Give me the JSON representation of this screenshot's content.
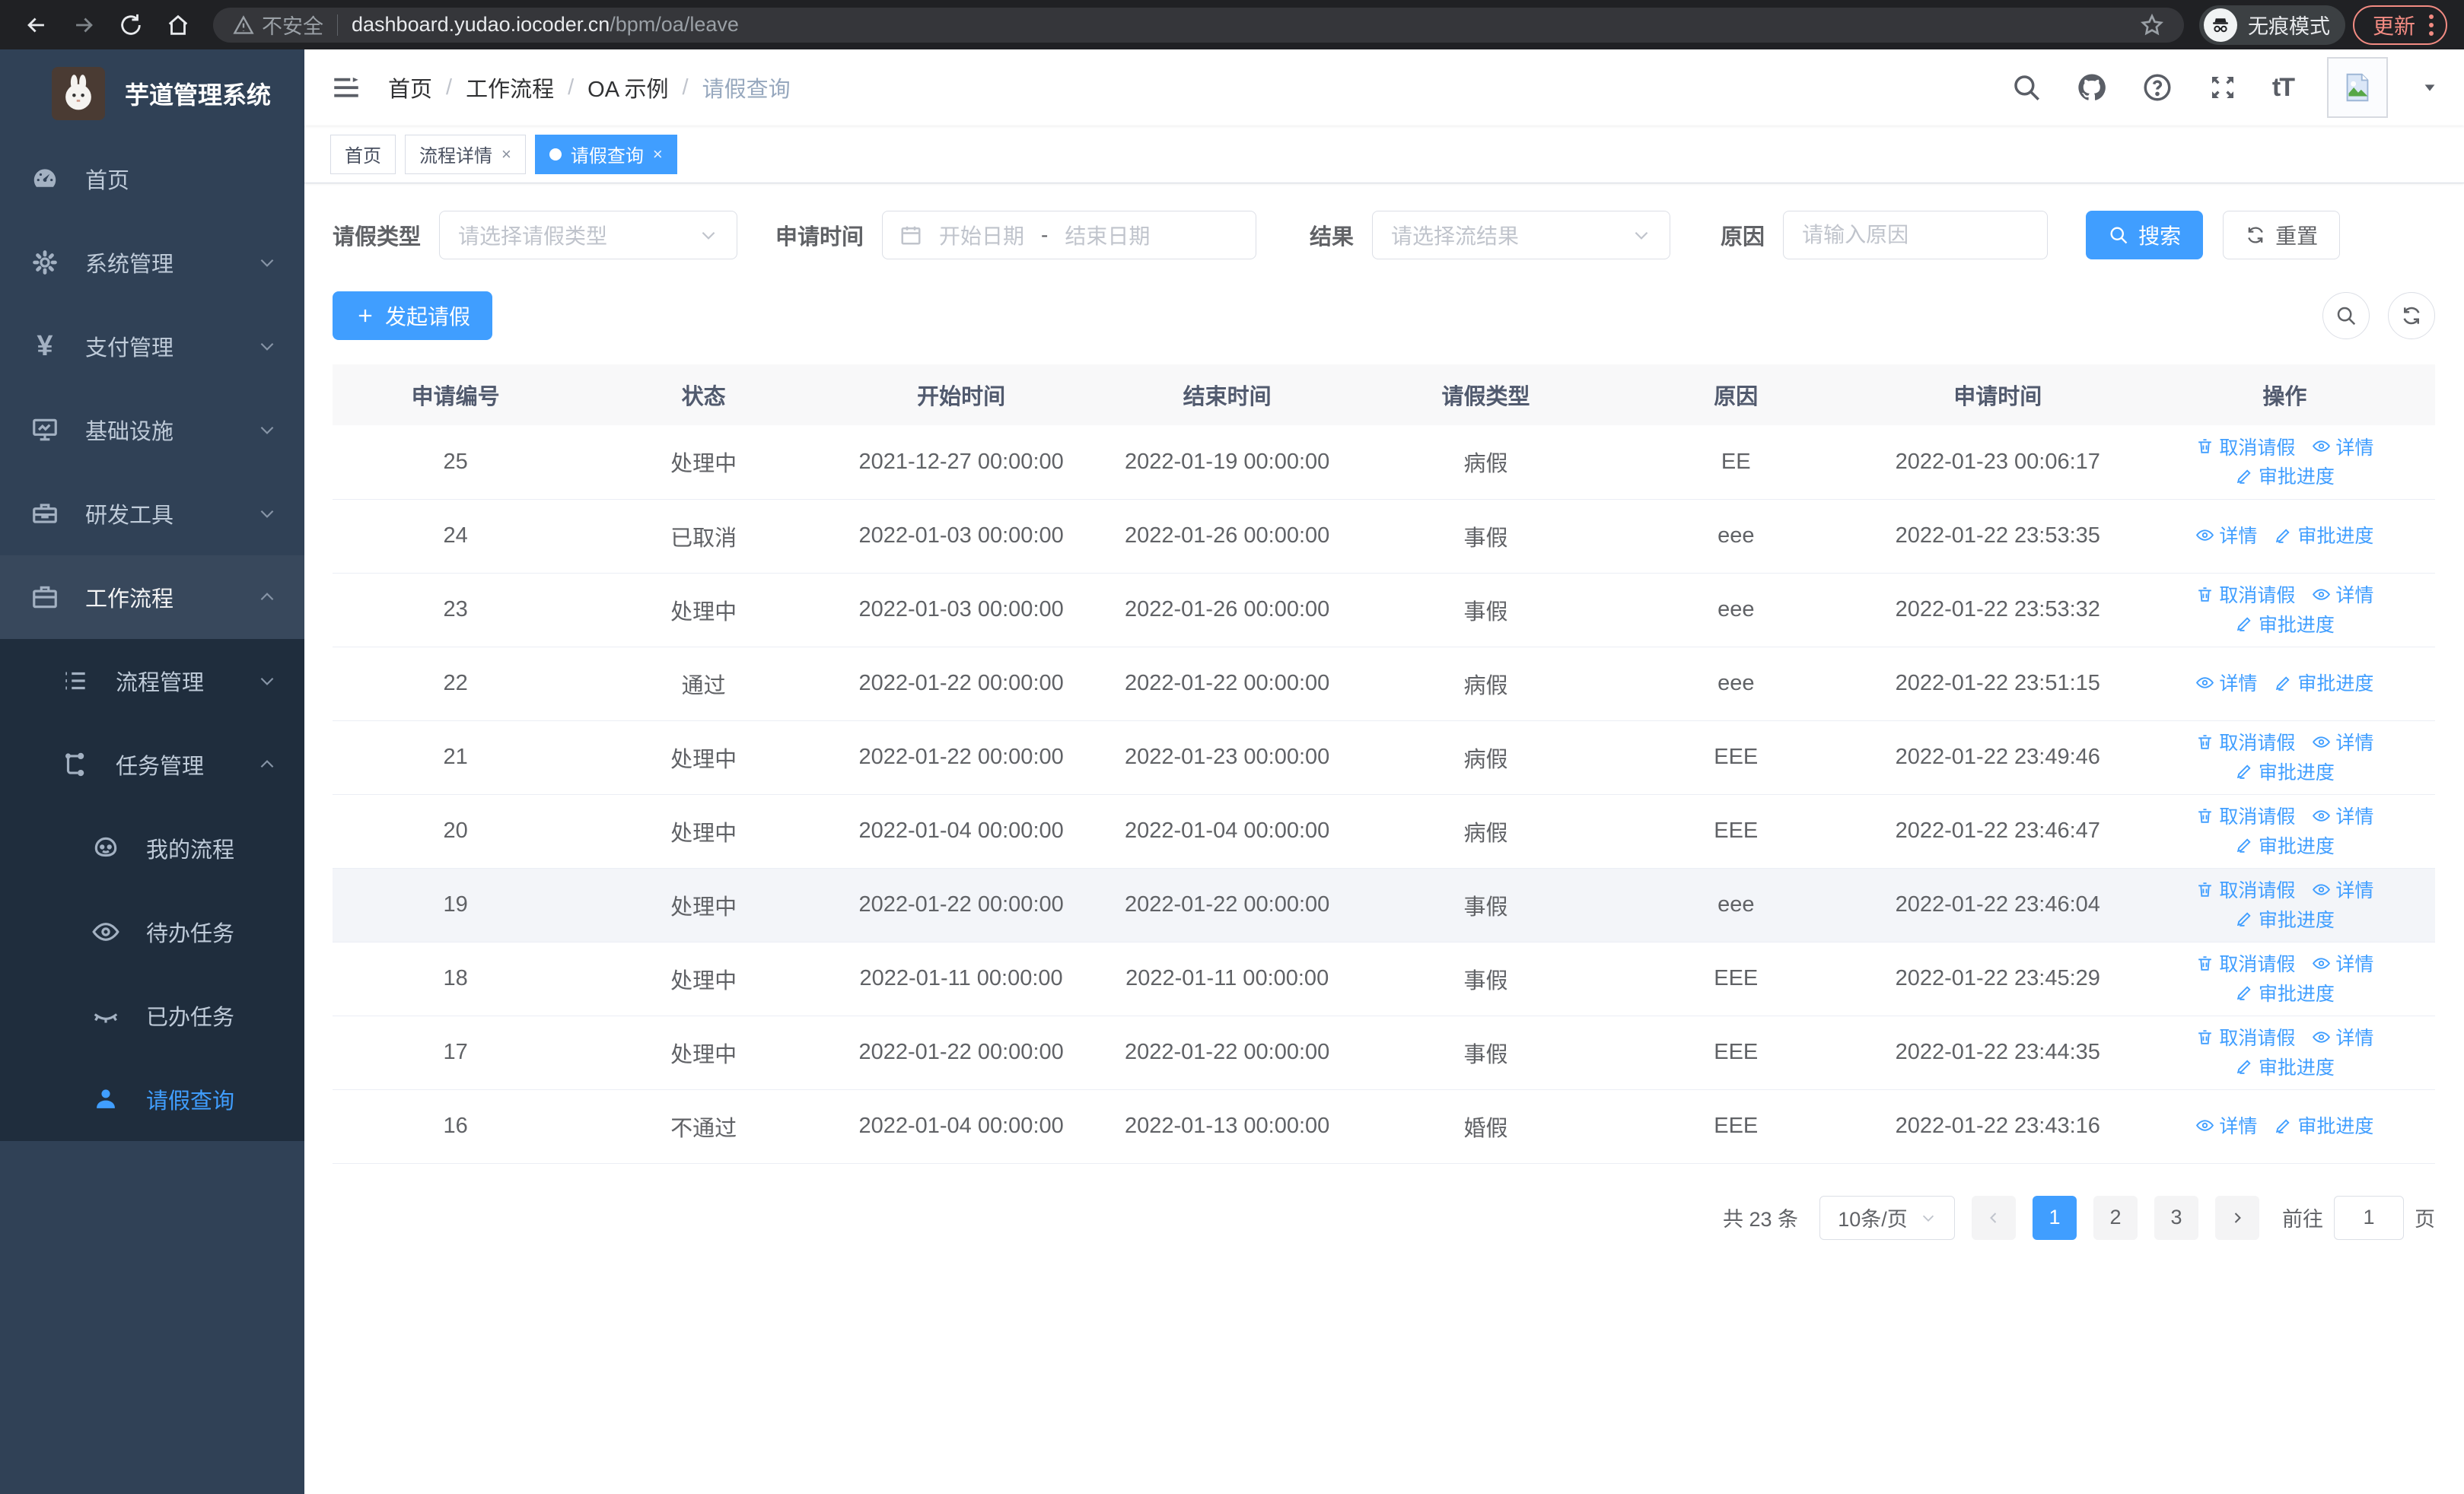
{
  "browser": {
    "not_secure_label": "不安全",
    "url_host": "dashboard.yudao.iocoder.cn",
    "url_path": "/bpm/oa/leave",
    "incognito_label": "无痕模式",
    "update_label": "更新"
  },
  "sidebar": {
    "title": "芋道管理系统",
    "items": [
      {
        "label": "首页"
      },
      {
        "label": "系统管理"
      },
      {
        "label": "支付管理"
      },
      {
        "label": "基础设施"
      },
      {
        "label": "研发工具"
      },
      {
        "label": "工作流程"
      }
    ],
    "submenu": [
      {
        "label": "流程管理"
      },
      {
        "label": "任务管理"
      },
      {
        "label": "我的流程"
      },
      {
        "label": "待办任务"
      },
      {
        "label": "已办任务"
      },
      {
        "label": "请假查询"
      }
    ],
    "yen_glyph": "¥"
  },
  "header": {
    "breadcrumb": [
      "首页",
      "工作流程",
      "OA 示例",
      "请假查询"
    ],
    "breadcrumb_separator": "/",
    "tabs": [
      {
        "label": "首页"
      },
      {
        "label": "流程详情"
      },
      {
        "label": "请假查询"
      }
    ],
    "tab_close_glyph": "×"
  },
  "filters": {
    "leave_type_label": "请假类型",
    "leave_type_placeholder": "请选择请假类型",
    "apply_time_label": "申请时间",
    "start_date_placeholder": "开始日期",
    "date_separator": "-",
    "end_date_placeholder": "结束日期",
    "result_label": "结果",
    "result_placeholder": "请选择流结果",
    "reason_label": "原因",
    "reason_placeholder": "请输入原因",
    "search_label": "搜索",
    "reset_label": "重置"
  },
  "toolbar": {
    "create_label": "发起请假"
  },
  "table": {
    "columns": [
      "申请编号",
      "状态",
      "开始时间",
      "结束时间",
      "请假类型",
      "原因",
      "申请时间",
      "操作"
    ],
    "action_labels": {
      "cancel": "取消请假",
      "detail": "详情",
      "progress": "审批进度"
    },
    "rows": [
      {
        "id": "25",
        "status": "处理中",
        "start": "2021-12-27 00:00:00",
        "end": "2022-01-19 00:00:00",
        "type": "病假",
        "reason": "EE",
        "applied": "2022-01-23 00:06:17",
        "actions": [
          "cancel",
          "detail",
          "progress"
        ],
        "highlight": false
      },
      {
        "id": "24",
        "status": "已取消",
        "start": "2022-01-03 00:00:00",
        "end": "2022-01-26 00:00:00",
        "type": "事假",
        "reason": "eee",
        "applied": "2022-01-22 23:53:35",
        "actions": [
          "detail",
          "progress"
        ],
        "highlight": false
      },
      {
        "id": "23",
        "status": "处理中",
        "start": "2022-01-03 00:00:00",
        "end": "2022-01-26 00:00:00",
        "type": "事假",
        "reason": "eee",
        "applied": "2022-01-22 23:53:32",
        "actions": [
          "cancel",
          "detail",
          "progress"
        ],
        "highlight": false
      },
      {
        "id": "22",
        "status": "通过",
        "start": "2022-01-22 00:00:00",
        "end": "2022-01-22 00:00:00",
        "type": "病假",
        "reason": "eee",
        "applied": "2022-01-22 23:51:15",
        "actions": [
          "detail",
          "progress"
        ],
        "highlight": false
      },
      {
        "id": "21",
        "status": "处理中",
        "start": "2022-01-22 00:00:00",
        "end": "2022-01-23 00:00:00",
        "type": "病假",
        "reason": "EEE",
        "applied": "2022-01-22 23:49:46",
        "actions": [
          "cancel",
          "detail",
          "progress"
        ],
        "highlight": false
      },
      {
        "id": "20",
        "status": "处理中",
        "start": "2022-01-04 00:00:00",
        "end": "2022-01-04 00:00:00",
        "type": "病假",
        "reason": "EEE",
        "applied": "2022-01-22 23:46:47",
        "actions": [
          "cancel",
          "detail",
          "progress"
        ],
        "highlight": false
      },
      {
        "id": "19",
        "status": "处理中",
        "start": "2022-01-22 00:00:00",
        "end": "2022-01-22 00:00:00",
        "type": "事假",
        "reason": "eee",
        "applied": "2022-01-22 23:46:04",
        "actions": [
          "cancel",
          "detail",
          "progress"
        ],
        "highlight": true
      },
      {
        "id": "18",
        "status": "处理中",
        "start": "2022-01-11 00:00:00",
        "end": "2022-01-11 00:00:00",
        "type": "事假",
        "reason": "EEE",
        "applied": "2022-01-22 23:45:29",
        "actions": [
          "cancel",
          "detail",
          "progress"
        ],
        "highlight": false
      },
      {
        "id": "17",
        "status": "处理中",
        "start": "2022-01-22 00:00:00",
        "end": "2022-01-22 00:00:00",
        "type": "事假",
        "reason": "EEE",
        "applied": "2022-01-22 23:44:35",
        "actions": [
          "cancel",
          "detail",
          "progress"
        ],
        "highlight": false
      },
      {
        "id": "16",
        "status": "不通过",
        "start": "2022-01-04 00:00:00",
        "end": "2022-01-13 00:00:00",
        "type": "婚假",
        "reason": "EEE",
        "applied": "2022-01-22 23:43:16",
        "actions": [
          "detail",
          "progress"
        ],
        "highlight": false
      }
    ]
  },
  "pagination": {
    "total_label": "共 23 条",
    "page_size_label": "10条/页",
    "pages": [
      "1",
      "2",
      "3"
    ],
    "active_page": "1",
    "goto_label": "前往",
    "goto_value": "1",
    "page_suffix_label": "页"
  }
}
